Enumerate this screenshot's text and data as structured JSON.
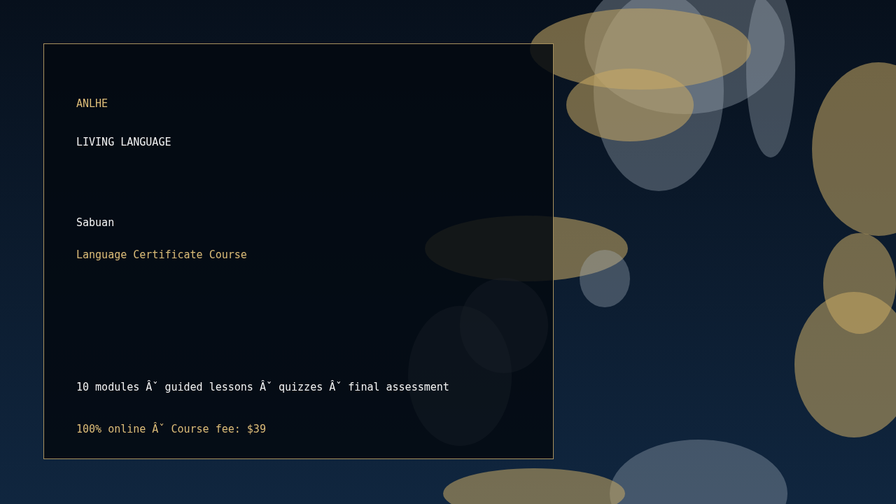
{
  "brand": "ANLHE",
  "headline": "LIVING LANGUAGE",
  "name": "Sabuan",
  "course": "Language Certificate Course",
  "details": "10 modules Âˇ guided lessons Âˇ quizzes Âˇ final assessment",
  "footer": "100% online Âˇ Course fee: $39"
}
